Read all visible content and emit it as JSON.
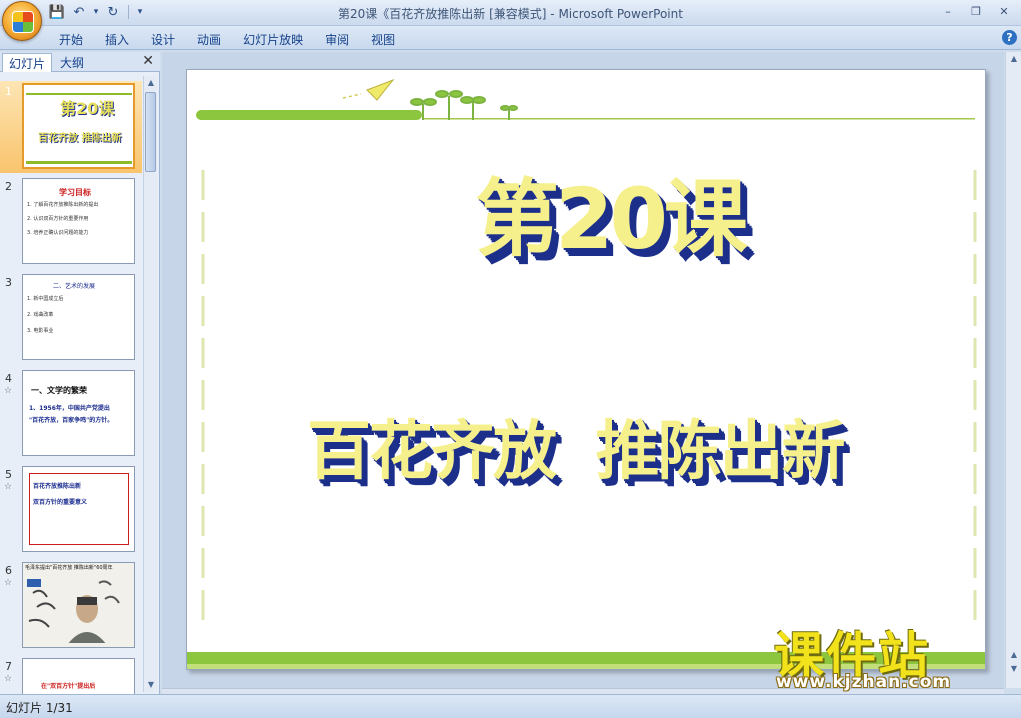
{
  "window": {
    "title": "第20课《百花齐放推陈出新 [兼容模式] - Microsoft PowerPoint",
    "min": "–",
    "max": "❐",
    "close": "✕"
  },
  "qat": {
    "save": "💾",
    "undo": "↶",
    "redo": "↻",
    "more": "▾"
  },
  "ribbon": {
    "tabs": [
      "开始",
      "插入",
      "设计",
      "动画",
      "幻灯片放映",
      "审阅",
      "视图"
    ],
    "help": "?"
  },
  "pane": {
    "tab_slides": "幻灯片",
    "tab_outline": "大纲",
    "close": "✕",
    "slides": [
      {
        "num": "1",
        "mark": "",
        "title": "第20课",
        "subtitle": "百花齐放 推陈出新"
      },
      {
        "num": "2",
        "mark": "",
        "title": "学习目标",
        "lines": [
          "1. 了解百花齐放推陈出新的提出",
          "2. 认识双百方针的重要作用",
          "3. 培养正确认识问题的能力"
        ]
      },
      {
        "num": "3",
        "mark": "",
        "title": "二、艺术的发展",
        "lines": [
          "1. 新中国成立后",
          "2. 戏曲改革",
          "3. 电影事业"
        ]
      },
      {
        "num": "4",
        "mark": "☆",
        "title": "一、文学的繁荣",
        "lines": [
          "1、1956年，中国共产党提出",
          "\"百花齐放，百家争鸣\"的方针。"
        ]
      },
      {
        "num": "5",
        "mark": "☆",
        "title": "",
        "lines": [
          "百花齐放推陈出新",
          "双百方针的重要意义"
        ]
      },
      {
        "num": "6",
        "mark": "☆",
        "title": "毛泽东提出\"百花齐放 推陈出新\"60周年",
        "lines": []
      },
      {
        "num": "7",
        "mark": "☆",
        "title": "在\"双百方针\"提出后",
        "lines": []
      }
    ]
  },
  "slide": {
    "title": "第20课",
    "subtitle": "百花齐放  推陈出新"
  },
  "status": {
    "text": "幻灯片 1/31"
  },
  "watermark": {
    "main": "课件站",
    "url": "www.kjzhan.com"
  }
}
